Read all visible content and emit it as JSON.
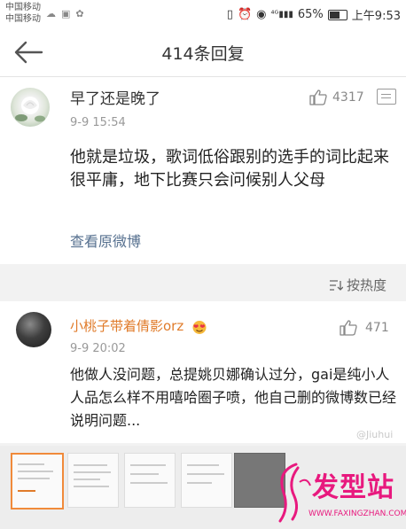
{
  "status_bar": {
    "carrier_1": "中国移动",
    "carrier_2": "中国移动",
    "battery": "65%",
    "time": "上午9:53",
    "battery_level": 0.65
  },
  "header": {
    "title": "414条回复",
    "back_icon": "arrow-left-icon"
  },
  "original_comment": {
    "username": "早了还是晚了",
    "time": "9-9 15:54",
    "likes": "4317",
    "text": "他就是垃圾，歌词低俗跟别的选手的词比起来很平庸，地下比赛只会问候别人父母",
    "view_original": "查看原微博"
  },
  "sort": {
    "label": "按热度"
  },
  "reply": {
    "username": "小桃子带着倩影orz",
    "time": "9-9 20:02",
    "likes": "471",
    "text": "他做人没问题，总提姚贝娜确认过分，gai是纯小人 人品怎么样不用嘻哈圈子喷，他自己删的微博数已经说明问题...",
    "watermark": "@Jiuhui"
  },
  "branding": {
    "logo_text": "发型站",
    "logo_url": "WWW.FAXINGZHAN.COM",
    "color": "#e8197e"
  },
  "colors": {
    "link": "#56708f",
    "username_highlight": "#e07b2a",
    "selected_thumb_border": "#f08a3a"
  }
}
